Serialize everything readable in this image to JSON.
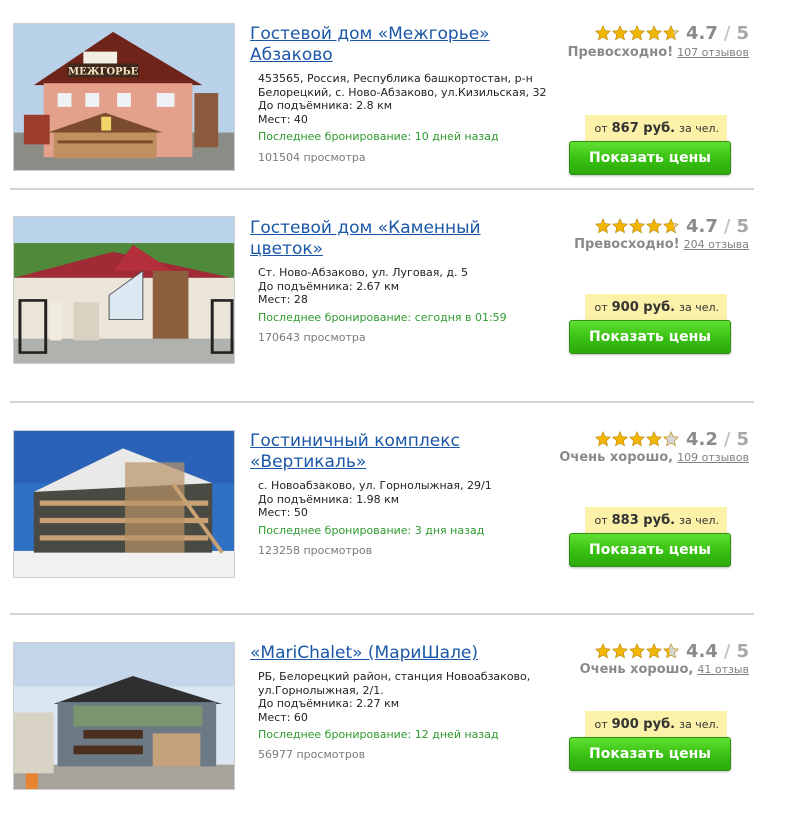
{
  "listings": [
    {
      "title": "Гостевой дом «Межгорье» Абзаково",
      "address": "453565, Россия, Республика башкортостан, р-н Белорецкий, с. Ново-Абзаково, ул.Кизильская, 32",
      "lift_distance": "До подъёмника: 2.8 км",
      "seats": "Мест: 40",
      "last_booking": "Последнее бронирование: 10 дней назад",
      "views": "101504 просмотра",
      "score": "4.7",
      "max": "5",
      "stars": 4.7,
      "verdict": "Превосходно!",
      "reviews": "107 отзывов",
      "price_from": "от",
      "price_amount": "867 руб.",
      "price_unit": "за чел.",
      "button": "Показать цены",
      "sign": "МЕЖГОРЬЕ"
    },
    {
      "title": "Гостевой дом «Каменный цветок»",
      "address": "Ст. Ново-Абзаково, ул. Луговая, д. 5",
      "lift_distance": "До подъёмника: 2.67 км",
      "seats": "Мест: 28",
      "last_booking": "Последнее бронирование: сегодня в 01:59",
      "views": "170643 просмотра",
      "score": "4.7",
      "max": "5",
      "stars": 4.7,
      "verdict": "Превосходно!",
      "reviews": "204 отзыва",
      "price_from": "от",
      "price_amount": "900 руб.",
      "price_unit": "за чел.",
      "button": "Показать цены"
    },
    {
      "title": "Гостиничный комплекс «Вертикаль»",
      "address": "с. Новоабзаково, ул. Горнолыжная, 29/1",
      "lift_distance": "До подъёмника: 1.98 км",
      "seats": "Мест: 50",
      "last_booking": "Последнее бронирование: 3 дня назад",
      "views": "123258 просмотров",
      "score": "4.2",
      "max": "5",
      "stars": 4.2,
      "verdict": "Очень хорошо,",
      "reviews": "109 отзывов",
      "price_from": "от",
      "price_amount": "883 руб.",
      "price_unit": "за чел.",
      "button": "Показать цены"
    },
    {
      "title": "«MariChalet» (МариШале)",
      "address": "РБ, Белорецкий район, станция Новоабзаково, ул.Горнолыжная, 2/1.",
      "lift_distance": "До подъёмника: 2.27 км",
      "seats": "Мест: 60",
      "last_booking": "Последнее бронирование: 12 дней назад",
      "views": "56977 просмотров",
      "score": "4.4",
      "max": "5",
      "stars": 4.4,
      "verdict": "Очень хорошо,",
      "reviews": "41 отзыв",
      "price_from": "от",
      "price_amount": "900 руб.",
      "price_unit": "за чел.",
      "button": "Показать цены"
    }
  ],
  "colors": {
    "link": "#1a57a8",
    "booking_green": "#2e9a2e",
    "button_green": "#38c012",
    "price_bg": "#fbf1a8",
    "star_gold": "#f2b705"
  }
}
